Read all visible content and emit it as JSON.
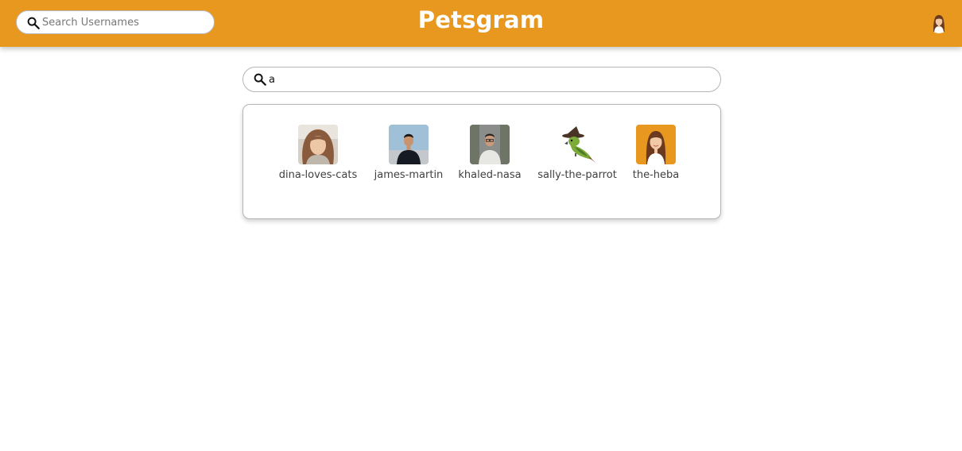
{
  "header": {
    "brand": "Petsgram",
    "search_placeholder": "Search Usernames",
    "search_value": "",
    "background_color": "#e8981f"
  },
  "main_search": {
    "value": "a",
    "placeholder": ""
  },
  "results": {
    "users": [
      {
        "username": "dina-loves-cats",
        "avatar": "photo-woman-curly-hair"
      },
      {
        "username": "james-martin",
        "avatar": "photo-man-black-shirt"
      },
      {
        "username": "khaled-nasa",
        "avatar": "photo-man-glasses"
      },
      {
        "username": "sally-the-parrot",
        "avatar": "parrot-with-witch-hat"
      },
      {
        "username": "the-heba",
        "avatar": "illustrated-woman-on-orange"
      }
    ]
  }
}
